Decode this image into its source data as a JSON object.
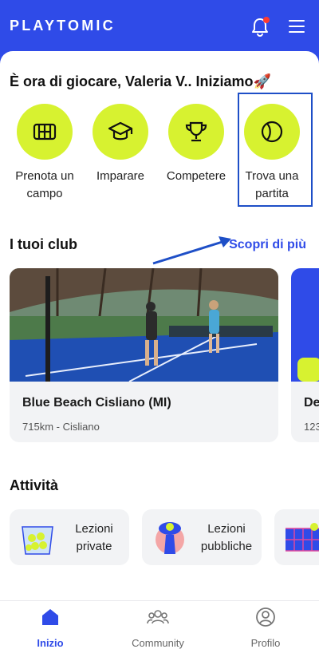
{
  "header": {
    "logo": "PLAYTOMIC",
    "accent": "#2f4be8",
    "notification_dot": "#ff3b30"
  },
  "greeting": "È ora di giocare, Valeria V.. Iniziamo🚀",
  "quick_actions": [
    {
      "label": "Prenota un campo",
      "icon": "court-icon"
    },
    {
      "label": "Imparare",
      "icon": "graduation-cap-icon"
    },
    {
      "label": "Competere",
      "icon": "trophy-icon"
    },
    {
      "label": "Trova una partita",
      "icon": "ball-icon"
    }
  ],
  "clubs": {
    "title": "I tuoi club",
    "link": "Scopri di più",
    "cards": [
      {
        "name": "Blue Beach Cisliano (MI)",
        "sub": "715km - Cisliano"
      },
      {
        "name": "De",
        "sub": "123"
      }
    ]
  },
  "activities": {
    "title": "Attività",
    "cards": [
      {
        "label": "Lezioni private",
        "icon": "ball-basket-icon"
      },
      {
        "label": "Lezioni pubbliche",
        "icon": "player-icon"
      },
      {
        "label": "",
        "icon": "net-icon"
      }
    ]
  },
  "nav": {
    "items": [
      {
        "label": "Inizio",
        "icon": "home-icon",
        "active": true
      },
      {
        "label": "Community",
        "icon": "community-icon",
        "active": false
      },
      {
        "label": "Profilo",
        "icon": "profile-icon",
        "active": false
      }
    ]
  },
  "colors": {
    "lime": "#d7f230",
    "brand_blue": "#2f4be8",
    "highlight": "#1e4fc7"
  }
}
